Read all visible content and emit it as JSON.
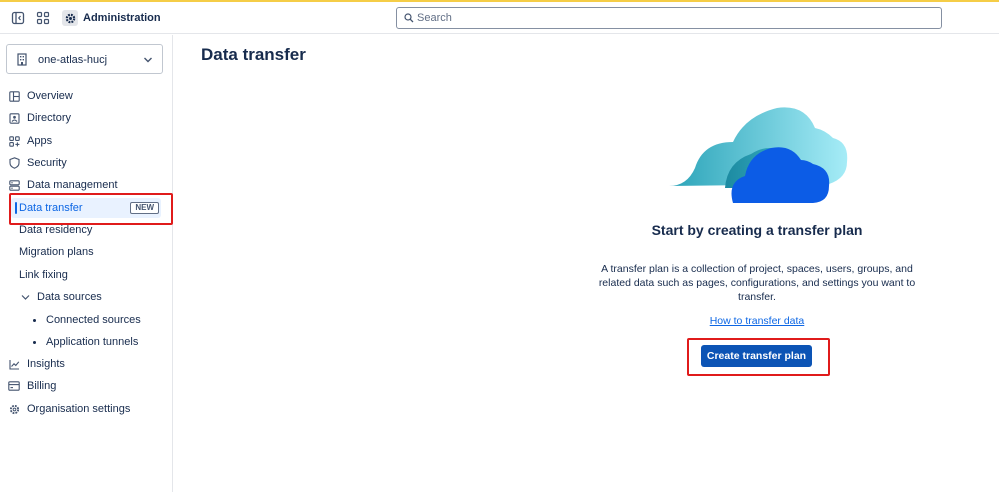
{
  "topbar": {
    "admin_title": "Administration",
    "search_placeholder": "Search",
    "icons": [
      "sidebar-toggle-icon",
      "app-switcher-icon",
      "settings-gear-icon",
      "search-icon"
    ]
  },
  "sidebar": {
    "org_name": "one-atlas-hucj",
    "items": [
      {
        "label": "Overview",
        "icon": "overview-icon"
      },
      {
        "label": "Directory",
        "icon": "directory-icon"
      },
      {
        "label": "Apps",
        "icon": "apps-icon"
      },
      {
        "label": "Security",
        "icon": "shield-icon"
      },
      {
        "label": "Data management",
        "icon": "database-icon"
      }
    ],
    "data_management_sub": [
      {
        "label": "Data transfer",
        "badge": "NEW",
        "active": true
      },
      {
        "label": "Data residency"
      },
      {
        "label": "Migration plans"
      },
      {
        "label": "Link fixing"
      },
      {
        "label": "Data sources"
      }
    ],
    "data_sources_sub": [
      {
        "label": "Connected sources"
      },
      {
        "label": "Application tunnels"
      }
    ],
    "bottom_items": [
      {
        "label": "Insights",
        "icon": "chart-icon"
      },
      {
        "label": "Billing",
        "icon": "billing-icon"
      },
      {
        "label": "Organisation settings",
        "icon": "gear-icon"
      }
    ]
  },
  "main": {
    "page_title": "Data transfer",
    "empty_heading": "Start by creating a transfer plan",
    "empty_description": "A transfer plan is a collection of project, spaces, users, groups, and related data such as pages, configurations, and settings you want to transfer.",
    "help_link": "How to transfer data",
    "primary_button": "Create transfer plan"
  },
  "colors": {
    "accent": "#0c66e4",
    "primary_button": "#0c54b5",
    "highlight_box": "#e01b1b",
    "active_bg": "#e9f2ff",
    "top_stripe": "#f5cd47"
  }
}
